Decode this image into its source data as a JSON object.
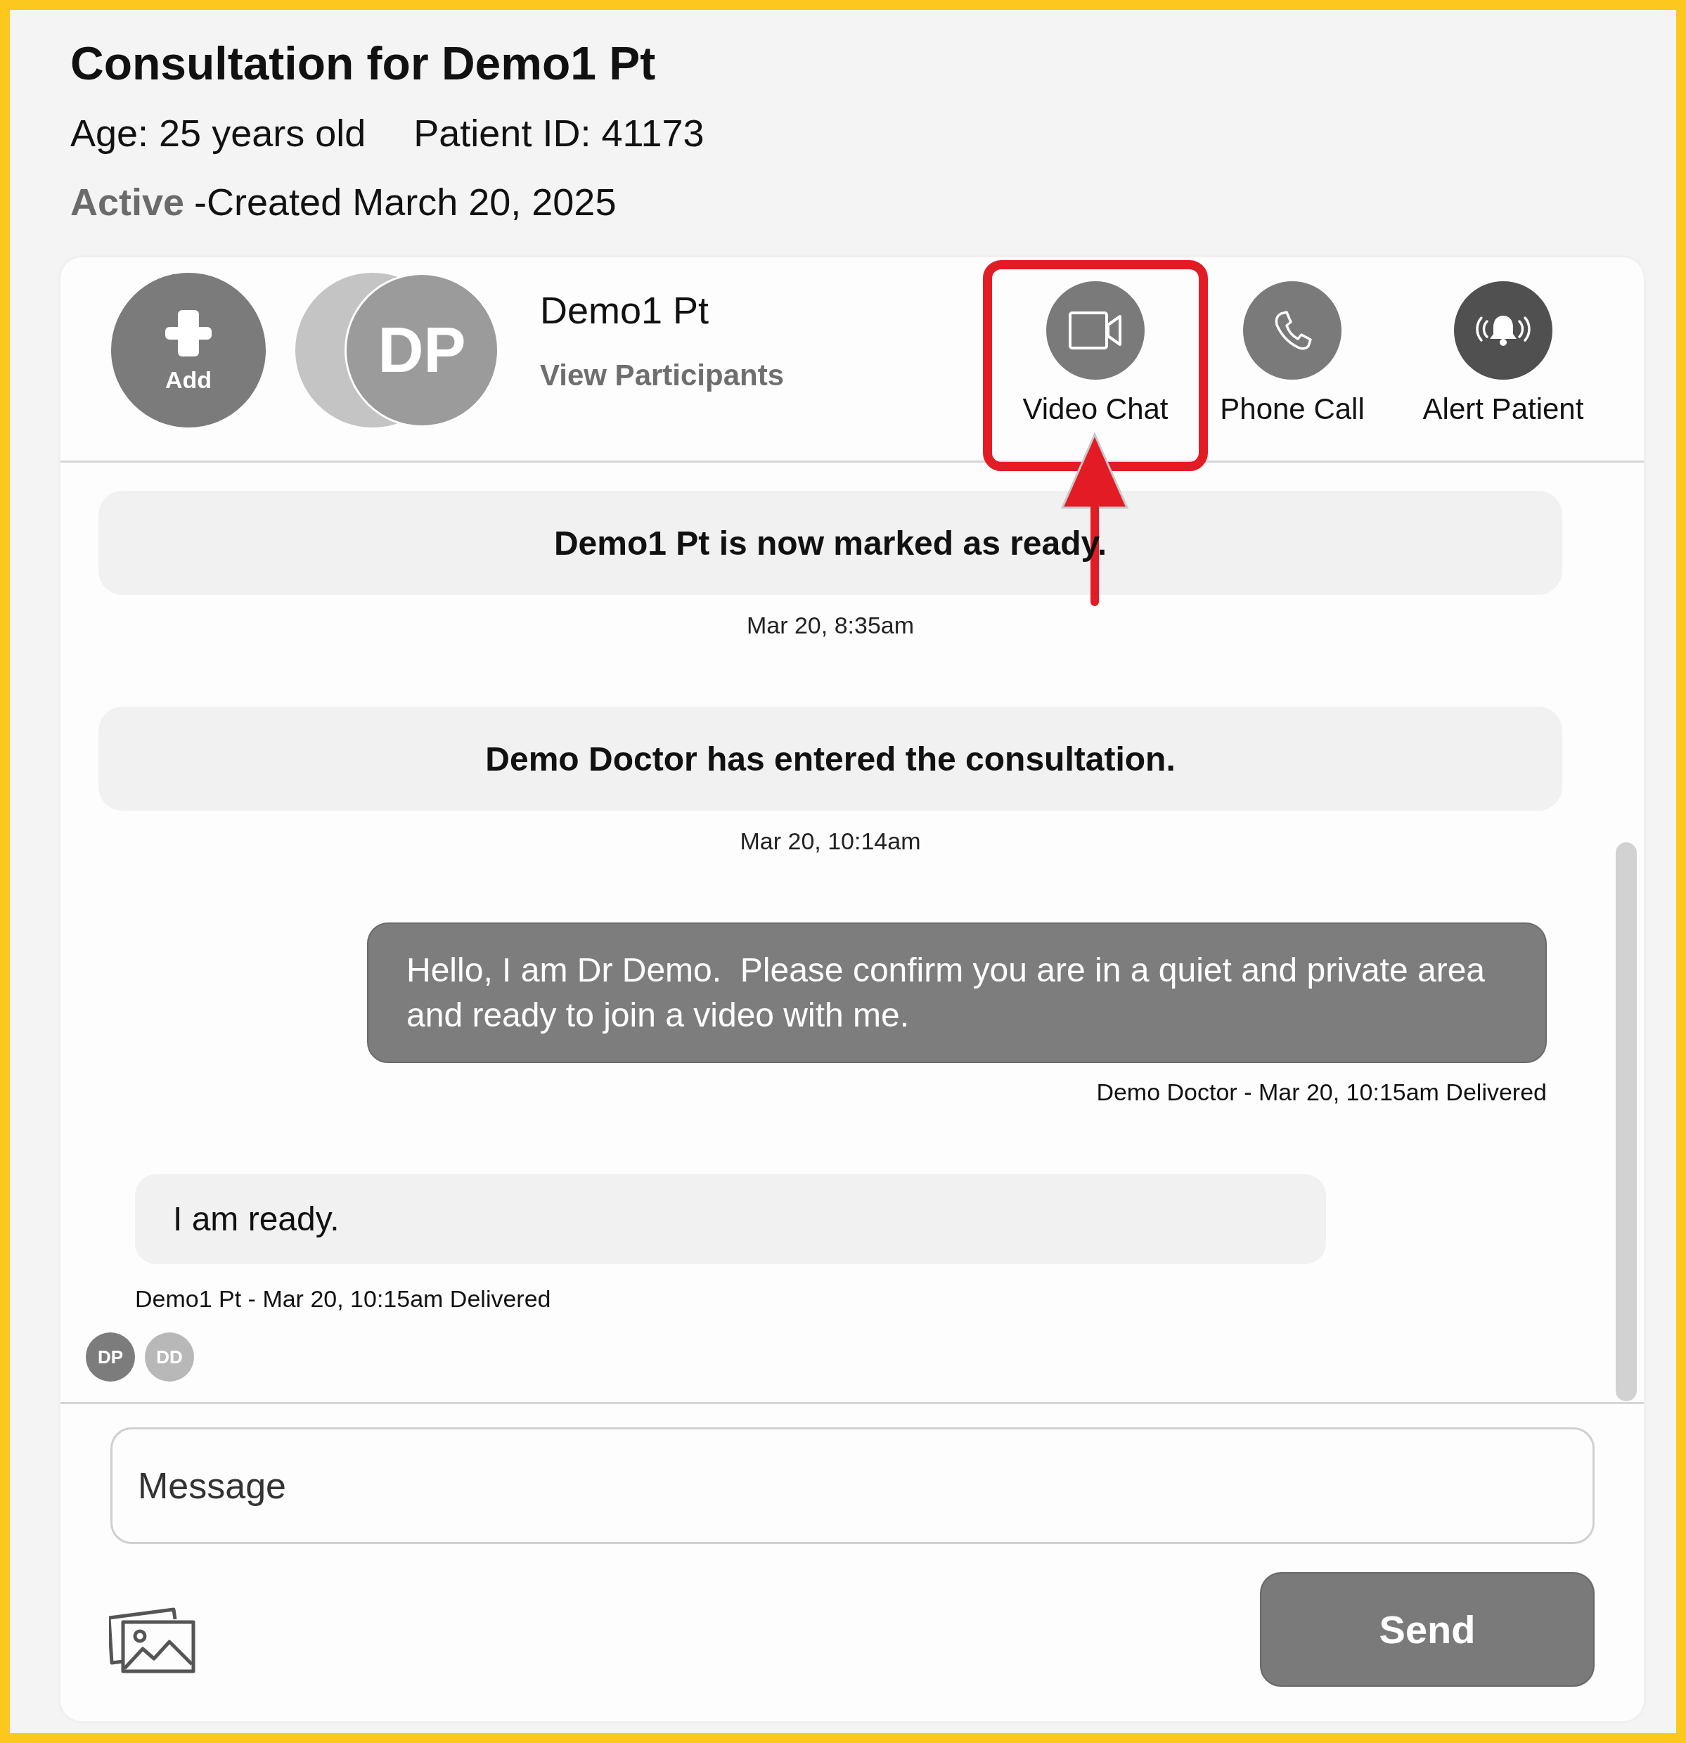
{
  "title": "Consultation for Demo1 Pt",
  "age": "Age: 25 years old",
  "patient_id": "Patient ID: 41173",
  "status": {
    "label": "Active",
    "created": "-Created March 20, 2025"
  },
  "header": {
    "add_button": "Add",
    "participants": [
      {
        "color": "#c4c4c4"
      },
      {
        "initials": "DP",
        "color": "#9b9b9b"
      }
    ],
    "name": "Demo1 Pt",
    "view_participants": "View Participants",
    "actions": [
      {
        "kind": "video",
        "label": "Video Chat",
        "highlighted": true
      },
      {
        "kind": "phone",
        "label": "Phone Call",
        "highlighted": false
      },
      {
        "kind": "alert",
        "label": "Alert Patient",
        "highlighted": false
      }
    ]
  },
  "messages": [
    {
      "kind": "system",
      "text": "Demo1 Pt is now marked as ready.",
      "time": "Mar 20, 8:35am"
    },
    {
      "kind": "system",
      "text": "Demo Doctor has entered the consultation.",
      "time": "Mar 20, 10:14am"
    },
    {
      "kind": "outgoing",
      "text": "Hello, I am Dr Demo.  Please confirm you are in a quiet and private area and ready to join a video with me.",
      "meta": "Demo Doctor - Mar 20, 10:15am Delivered"
    },
    {
      "kind": "incoming",
      "text": "I am ready.",
      "meta": "Demo1 Pt - Mar 20, 10:15am Delivered"
    }
  ],
  "read_by": [
    {
      "initials": "DP",
      "color": "#7c7c7c"
    },
    {
      "initials": "DD",
      "color": "#b8b8b8"
    }
  ],
  "composer": {
    "placeholder": "Message",
    "send": "Send"
  }
}
